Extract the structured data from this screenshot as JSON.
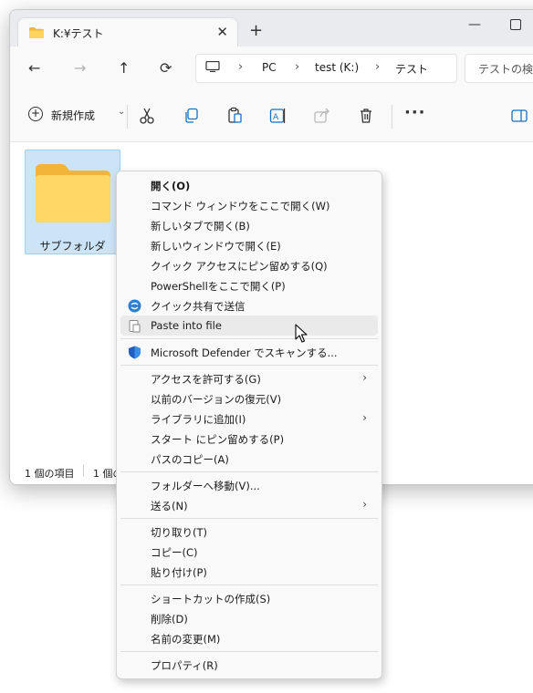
{
  "window": {
    "tab_title": "K:¥テスト",
    "new_tab": "+"
  },
  "nav": {
    "breadcrumbs": [
      "PC",
      "test (K:)",
      "テスト"
    ],
    "search_placeholder": "テストの検索"
  },
  "toolbar": {
    "new_label": "新規作成",
    "icons": [
      "cut-icon",
      "copy-icon",
      "paste-icon",
      "rename-icon",
      "share-icon",
      "delete-icon",
      "more-icon",
      "details-pane-icon"
    ]
  },
  "content": {
    "folder_name": "サブフォルダ"
  },
  "status": {
    "count": "1 個の項目",
    "selected": "1 個の"
  },
  "menu": {
    "items": [
      {
        "label": "開く(O)",
        "bold": true
      },
      {
        "label": "コマンド ウィンドウをここで開く(W)"
      },
      {
        "label": "新しいタブで開く(B)"
      },
      {
        "label": "新しいウィンドウで開く(E)"
      },
      {
        "label": "クイック アクセスにピン留めする(Q)"
      },
      {
        "label": "PowerShellをここで開く(P)"
      },
      {
        "label": "クイック共有で送信",
        "icon": "quick-share-icon"
      },
      {
        "label": "Paste into file",
        "icon": "paste-into-file-icon",
        "hover": true
      },
      {
        "label": "Microsoft Defender でスキャンする...",
        "icon": "defender-shield-icon"
      },
      {
        "label": "アクセスを許可する(G)",
        "submenu": true
      },
      {
        "label": "以前のバージョンの復元(V)"
      },
      {
        "label": "ライブラリに追加(I)",
        "submenu": true
      },
      {
        "label": "スタート にピン留めする(P)"
      },
      {
        "label": "パスのコピー(A)"
      },
      {
        "label": "フォルダーへ移動(V)..."
      },
      {
        "label": "送る(N)",
        "submenu": true
      },
      {
        "label": "切り取り(T)"
      },
      {
        "label": "コピー(C)"
      },
      {
        "label": "貼り付け(P)"
      },
      {
        "label": "ショートカットの作成(S)"
      },
      {
        "label": "削除(D)"
      },
      {
        "label": "名前の変更(M)"
      },
      {
        "label": "プロパティ(R)"
      }
    ],
    "submenu_arrow": "›"
  }
}
